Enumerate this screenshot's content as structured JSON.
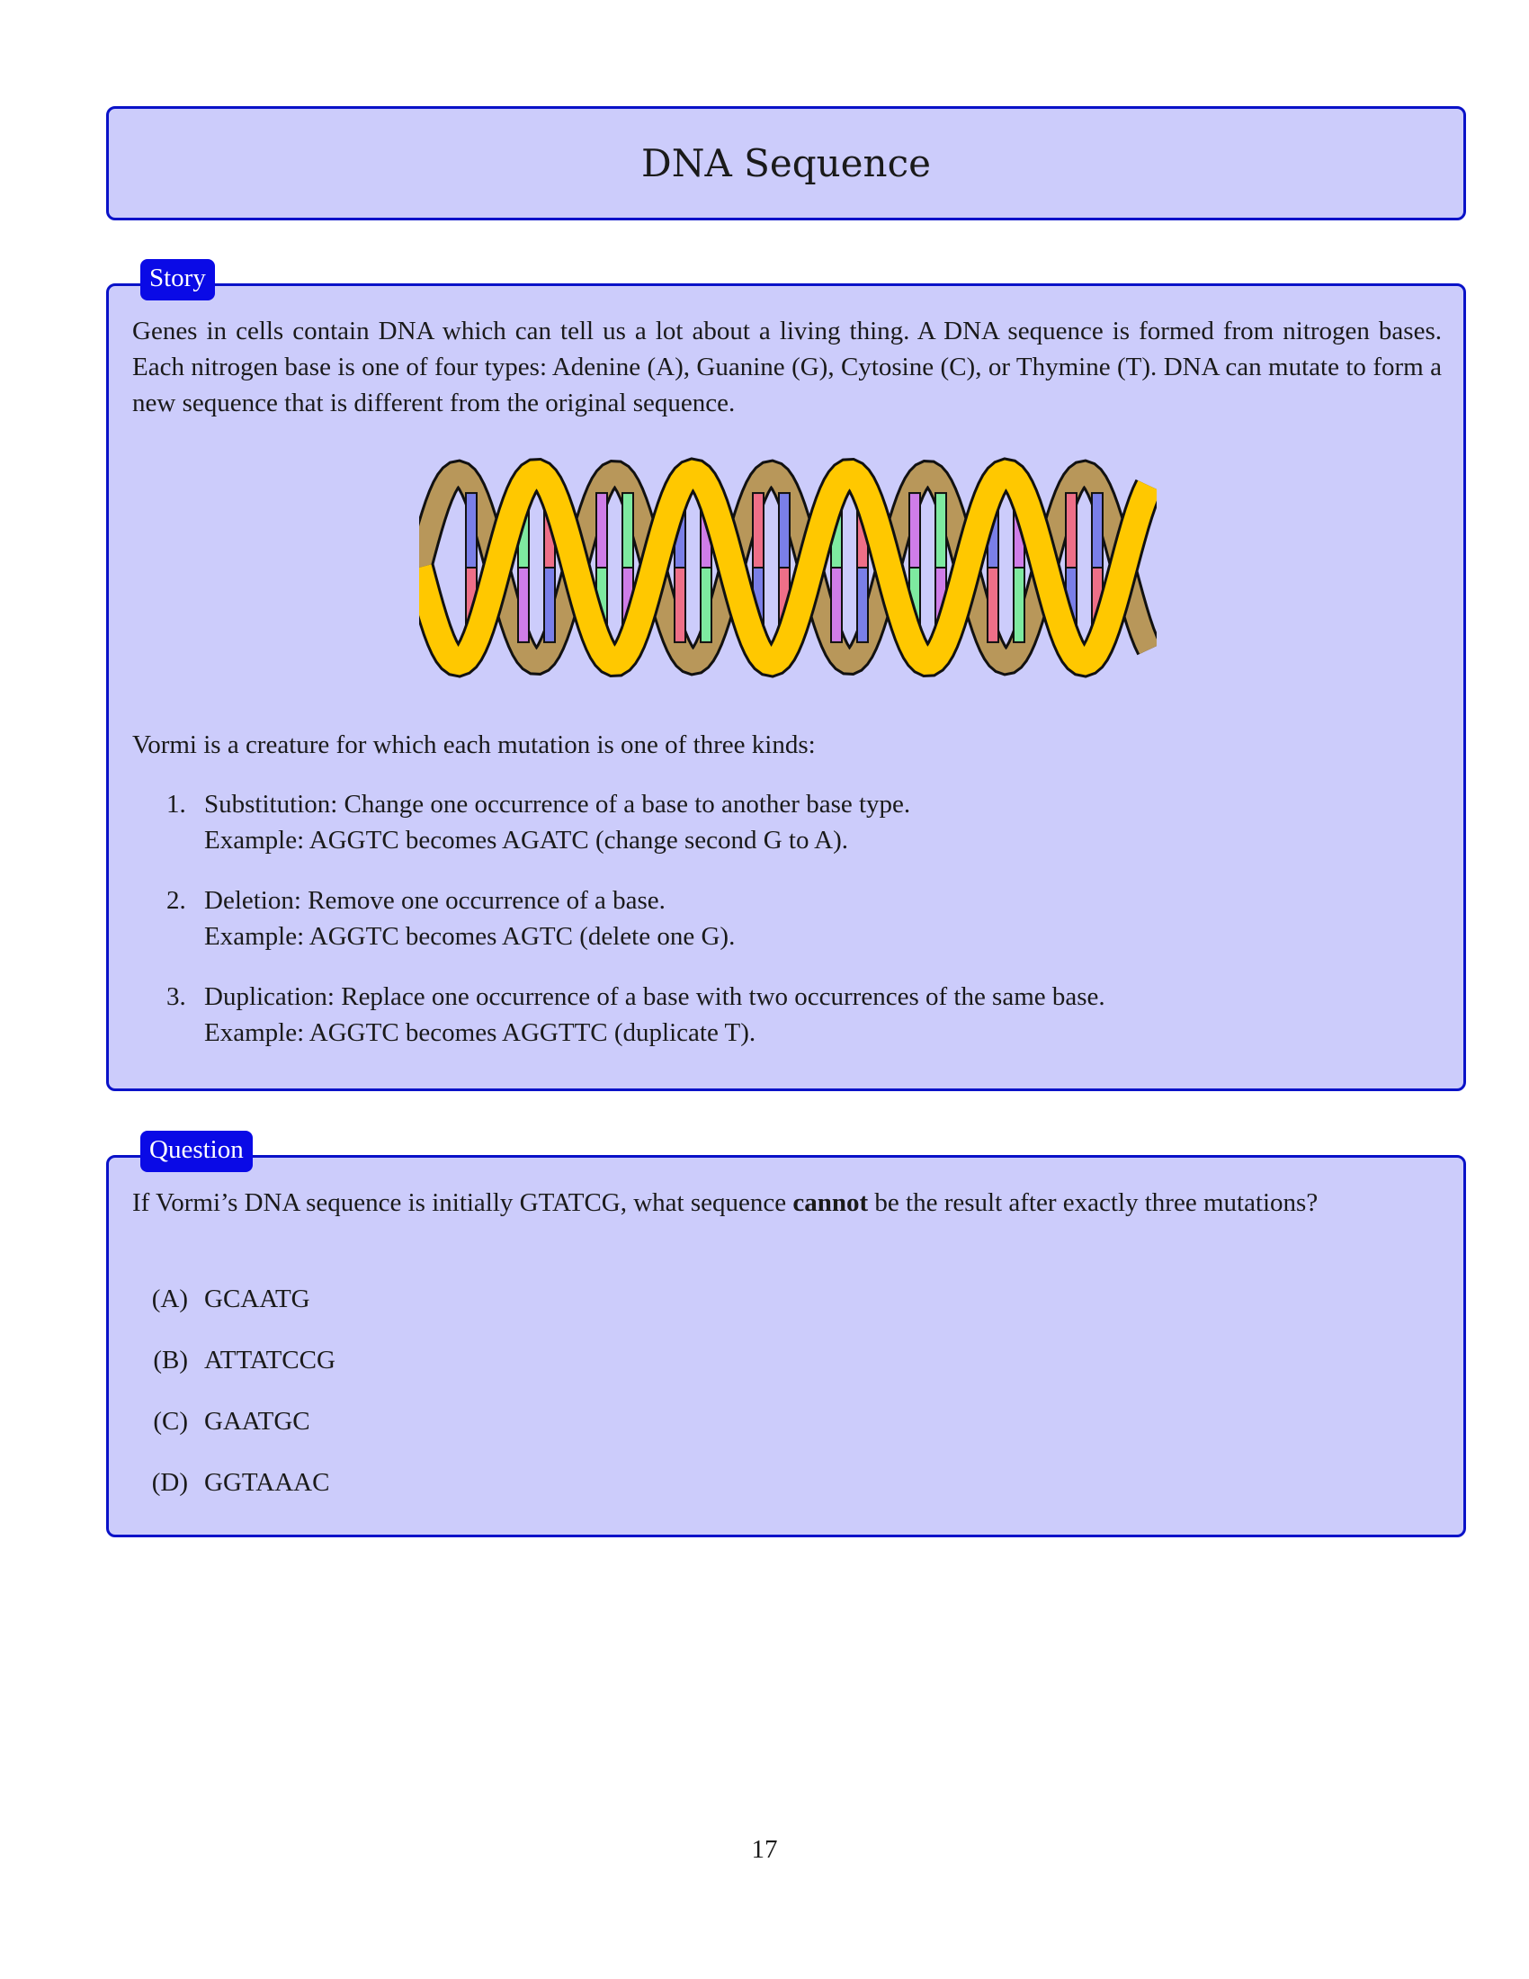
{
  "title": "DNA Sequence",
  "story": {
    "tag": "Story",
    "intro": "Genes in cells contain DNA which can tell us a lot about a living thing. A DNA sequence is formed from nitrogen bases. Each nitrogen base is one of four types: Adenine (A), Guanine (G), Cytosine (C), or Thymine (T). DNA can mutate to form a new sequence that is different from the original sequence.",
    "lead": "Vormi is a creature for which each mutation is one of three kinds:",
    "items": [
      {
        "number": "1.",
        "line1": "Substitution: Change one occurrence of a base to another base type.",
        "line2": "Example: AGGTC becomes AGATC (change second G to A)."
      },
      {
        "number": "2.",
        "line1": "Deletion: Remove one occurrence of a base.",
        "line2": "Example: AGGTC becomes AGTC (delete one G)."
      },
      {
        "number": "3.",
        "line1": "Duplication: Replace one occurrence of a base with two occurrences of the same base.",
        "line2": "Example: AGGTC becomes AGGTTC (duplicate T)."
      }
    ]
  },
  "question": {
    "tag": "Question",
    "text_before": "If Vormi’s DNA sequence is initially GTATCG, what sequence ",
    "text_bold": "cannot",
    "text_after": " be the result after exactly three mutations?",
    "options": [
      {
        "letter": "(A)",
        "value": "GCAATG"
      },
      {
        "letter": "(B)",
        "value": "ATTATCCG"
      },
      {
        "letter": "(C)",
        "value": "GAATGC"
      },
      {
        "letter": "(D)",
        "value": "GGTAAAC"
      }
    ]
  },
  "page_number": "17",
  "colors": {
    "box_fill": "#ccccfb",
    "box_border": "#0a12c8",
    "tag_fill": "#0a0ae6",
    "strand_front": "#ffc800",
    "strand_back": "#b8975a",
    "base_blue": "#7a7fe8",
    "base_violet": "#cf7de8",
    "base_red": "#ee6f88",
    "base_green": "#7eeaa0"
  }
}
